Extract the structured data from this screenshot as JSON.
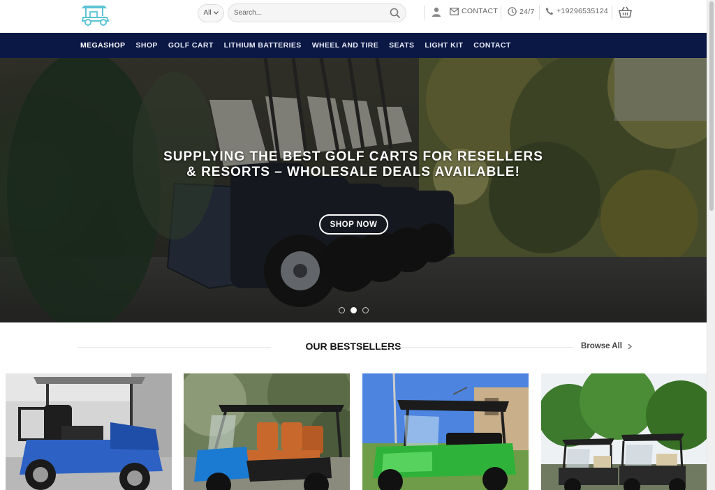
{
  "header": {
    "logo": "golf-cart-logo",
    "search": {
      "category_value": "All",
      "placeholder": "Search..."
    },
    "links": [
      {
        "icon": "user-icon",
        "label": ""
      },
      {
        "icon": "envelope-icon",
        "label": "CONTACT"
      },
      {
        "icon": "clock-icon",
        "label": "24/7"
      },
      {
        "icon": "phone-icon",
        "label": "+19296535124"
      }
    ],
    "cart_icon": "basket-icon"
  },
  "nav": {
    "items": [
      "MEGASHOP",
      "SHOP",
      "GOLF CART",
      "LITHIUM BATTERIES",
      "WHEEL AND TIRE",
      "SEATS",
      "LIGHT KIT",
      "CONTACT"
    ]
  },
  "hero": {
    "title_line1": "SUPPLYING THE BEST GOLF CARTS FOR RESELLERS",
    "title_line2": "& RESORTS – WHOLESALE DEALS AVAILABLE!",
    "button_label": "SHOP NOW",
    "slides": 3,
    "active_slide": 2
  },
  "bestsellers": {
    "title": "OUR BESTSELLERS",
    "browse_label": "Browse All",
    "products": [
      {
        "image": "blue-lifted-golf-cart"
      },
      {
        "image": "blue-cart-orange-seats"
      },
      {
        "image": "green-golf-cart"
      },
      {
        "image": "black-golf-carts-pair"
      }
    ]
  },
  "colors": {
    "nav_bg": "#0b1846",
    "accent_blue": "#2d62c4",
    "green_cart": "#2fb23a"
  }
}
